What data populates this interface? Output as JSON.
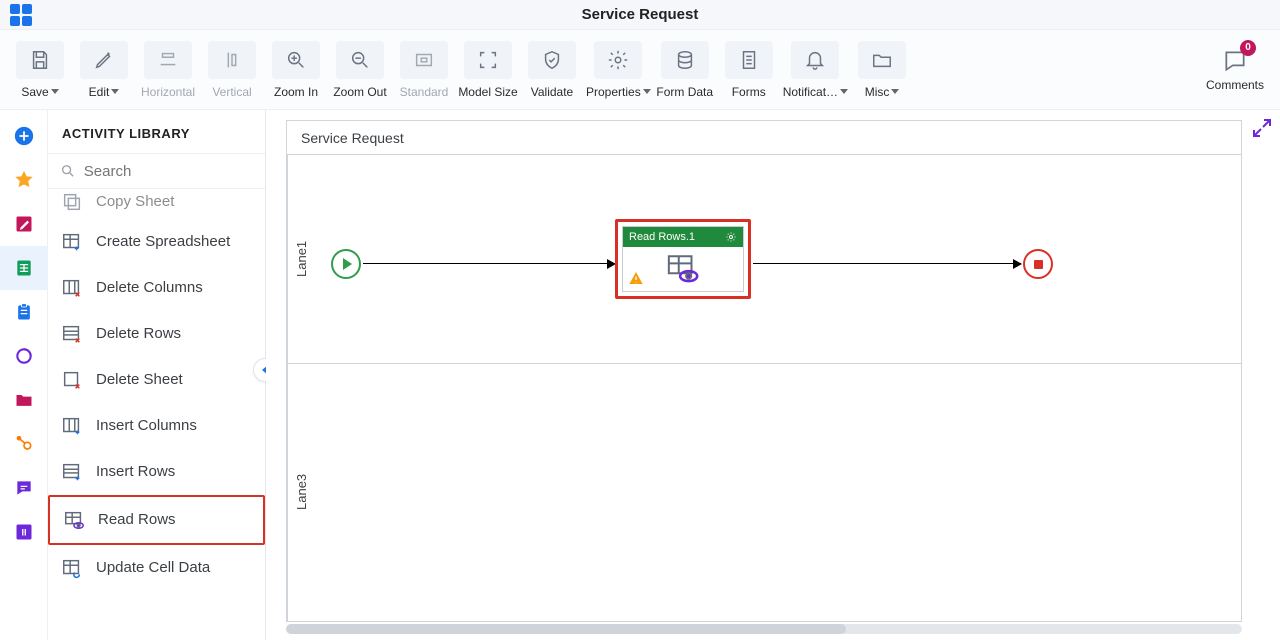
{
  "header": {
    "title": "Service Request"
  },
  "toolbar": {
    "save": "Save",
    "edit": "Edit",
    "horizontal": "Horizontal",
    "vertical": "Vertical",
    "zoom_in": "Zoom In",
    "zoom_out": "Zoom Out",
    "standard": "Standard",
    "model_size": "Model Size",
    "validate": "Validate",
    "properties": "Properties",
    "form_data": "Form Data",
    "forms": "Forms",
    "notifications": "Notificat…",
    "misc": "Misc",
    "comments": "Comments",
    "comments_count": "0"
  },
  "panel": {
    "title": "ACTIVITY LIBRARY",
    "search_placeholder": "Search",
    "items": [
      {
        "label": "Copy Sheet"
      },
      {
        "label": "Create Spreadsheet"
      },
      {
        "label": "Delete Columns"
      },
      {
        "label": "Delete Rows"
      },
      {
        "label": "Delete Sheet"
      },
      {
        "label": "Insert Columns"
      },
      {
        "label": "Insert Rows"
      },
      {
        "label": "Read Rows",
        "highlight": true
      },
      {
        "label": "Update Cell Data"
      }
    ]
  },
  "canvas": {
    "process_title": "Service Request",
    "lanes": [
      "Lane1",
      "Lane3"
    ],
    "task_title": "Read Rows.1"
  }
}
